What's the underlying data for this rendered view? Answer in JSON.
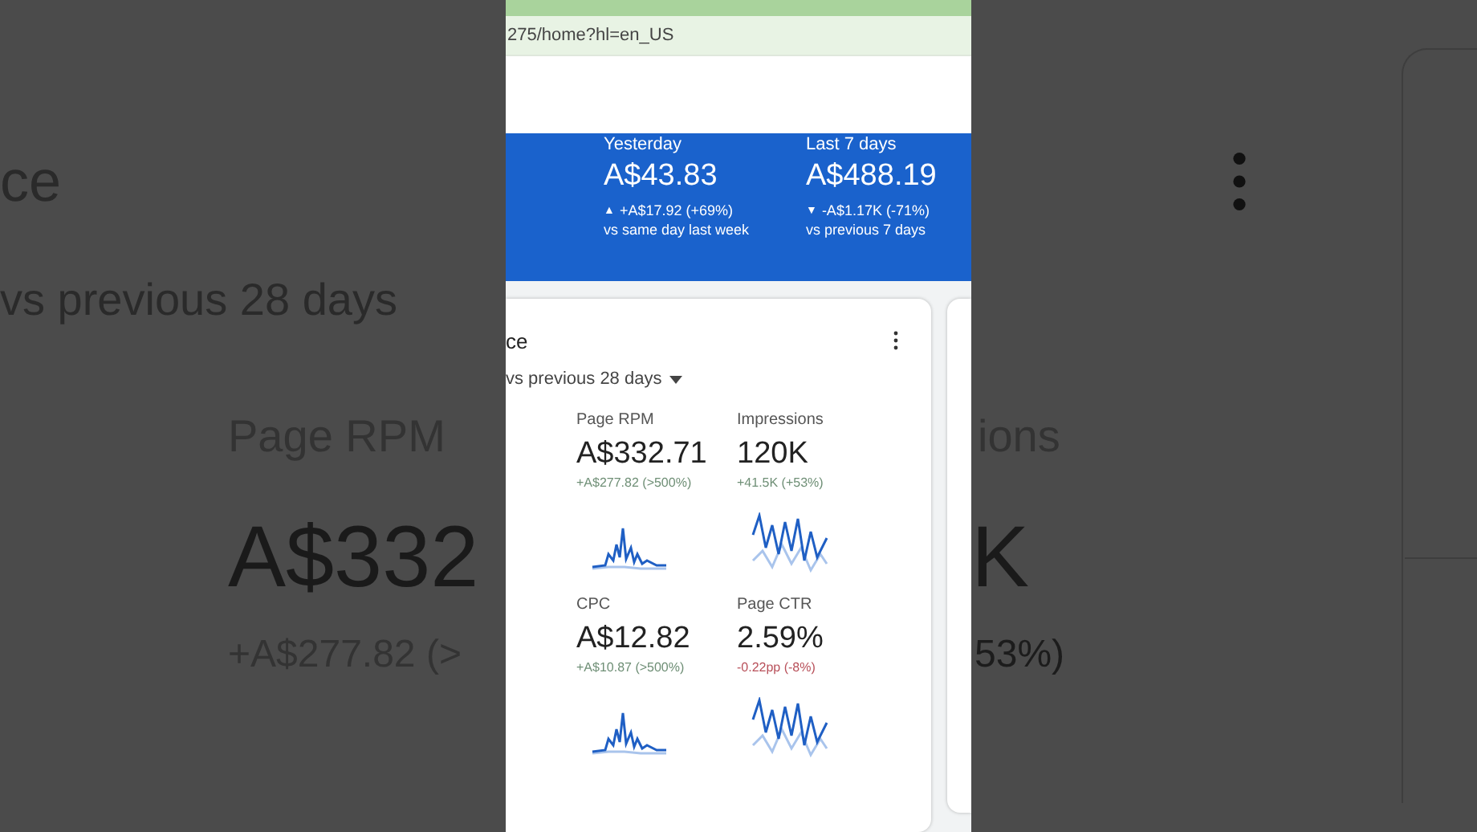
{
  "backdrop_left": {
    "title": "ce",
    "comparison": "vs previous 28 days",
    "metric_label": "Page RPM",
    "metric_value": "A$332",
    "metric_delta": "+A$277.82 (>"
  },
  "backdrop_right": {
    "metric_label": "ions",
    "metric_value": "K",
    "metric_delta": "53%)"
  },
  "browser": {
    "address": "275/home?hl=en_US"
  },
  "earnings": [
    {
      "label": "Yesterday",
      "value": "A$43.83",
      "marker": "▲",
      "change": "+A$17.92 (+69%)",
      "comparison": "vs same day last week"
    },
    {
      "label": "Last 7 days",
      "value": "A$488.19",
      "marker": "▼",
      "change": "-A$1.17K (-71%)",
      "comparison": "vs previous 7 days"
    }
  ],
  "performance_card": {
    "title": "ce",
    "period": "vs previous 28 days",
    "metrics": [
      {
        "label": "Page RPM",
        "value": "A$332.71",
        "change": "+A$277.82 (>500%)",
        "color": "#6f8f76",
        "kind": "spiky"
      },
      {
        "label": "Impressions",
        "value": "120K",
        "change": "+41.5K (+53%)",
        "color": "#6f8f76",
        "kind": "wavy"
      },
      {
        "label": "CPC",
        "value": "A$12.82",
        "change": "+A$10.87 (>500%)",
        "color": "#6f8f76",
        "kind": "spiky"
      },
      {
        "label": "Page CTR",
        "value": "2.59%",
        "change": "-0.22pp (-8%)",
        "color": "#b8505a",
        "kind": "wavy"
      }
    ]
  }
}
